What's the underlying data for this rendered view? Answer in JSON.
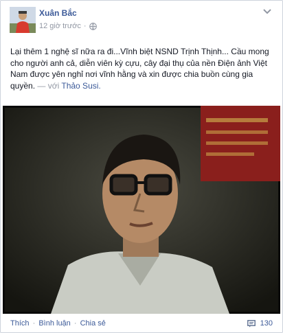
{
  "post": {
    "author": "Xuân Bắc",
    "time": "12 giờ trước",
    "separator": "·",
    "text": "Lại thêm 1 nghệ sĩ nữa ra đi...Vĩnh biệt NSND Trịnh Thịnh... Cầu mong cho người anh cả, diễn viên kỳ cựu, cây đại thụ của nền Điện ảnh Việt Nam được yên nghỉ nơi vĩnh hằng và xin được chia buồn cùng gia quyền.",
    "with_label": "— với",
    "tagged_person": "Thảo Susi."
  },
  "actions": {
    "like": "Thích",
    "comment": "Bình luận",
    "share": "Chia sẻ",
    "dot": "·",
    "comment_count": "130"
  },
  "icons": {
    "audience": "globe-icon",
    "options": "chevron-down-icon",
    "comments": "comment-icon"
  },
  "colors": {
    "link": "#3b5998",
    "meta": "#9197a3",
    "text": "#141823"
  }
}
